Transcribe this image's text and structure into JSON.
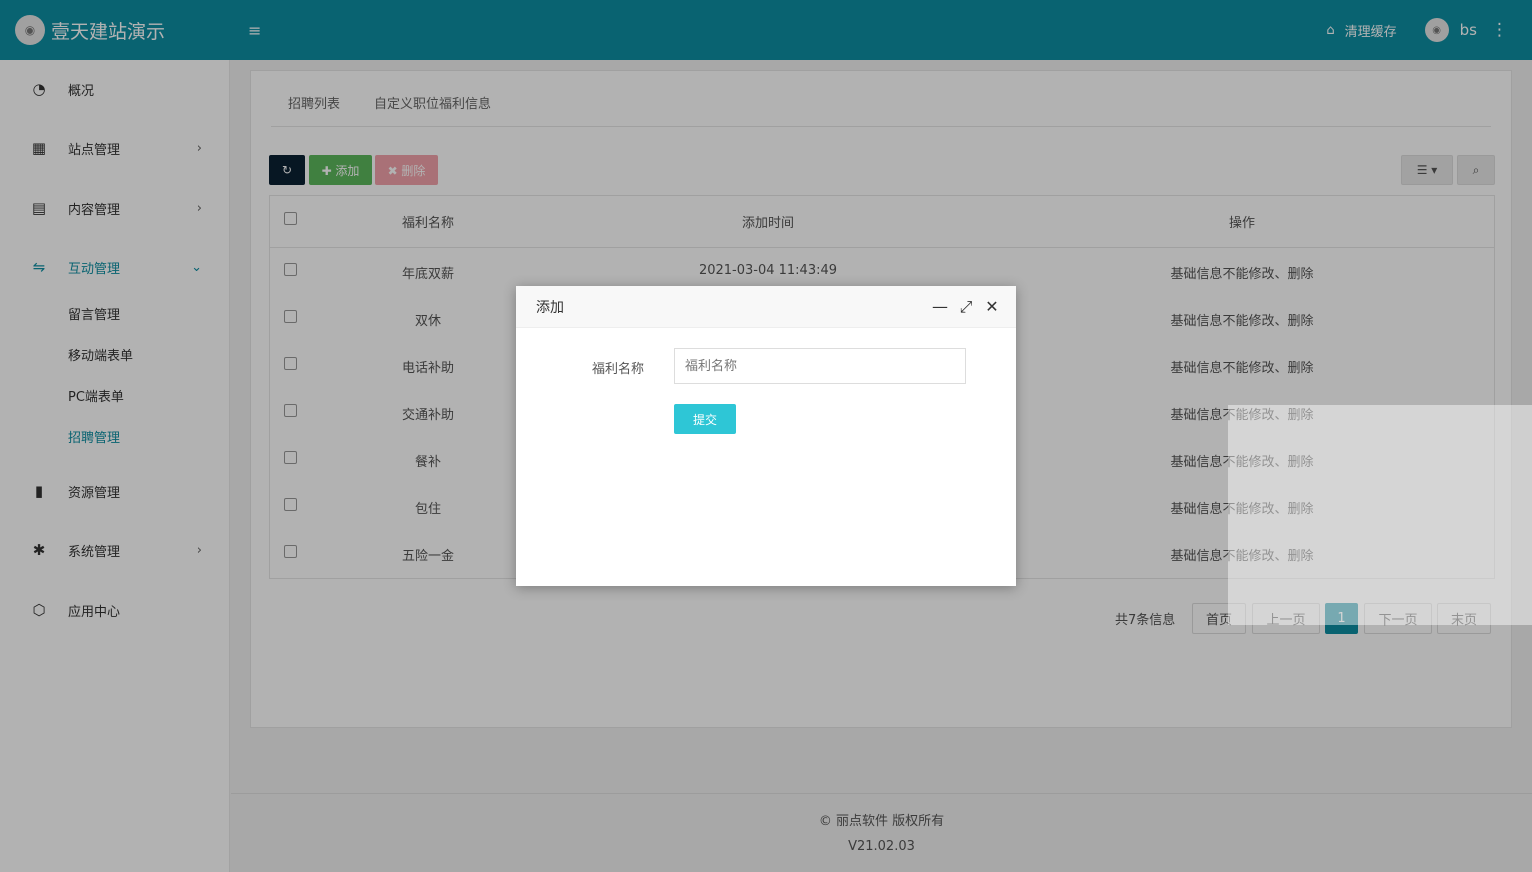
{
  "app": {
    "title": "壹天建站演示",
    "logo_icon": "logo-icon",
    "menu_icon": "≡"
  },
  "header": {
    "clear_cache": "清理缓存",
    "clear_cache_icon": "⌂",
    "user": "bs",
    "more_icon": "⋮"
  },
  "sidebar": {
    "items": [
      {
        "label": "概况",
        "icon": "◔"
      },
      {
        "label": "站点管理",
        "icon": "▦",
        "arrow": "›"
      },
      {
        "label": "内容管理",
        "icon": "▤",
        "arrow": "›"
      },
      {
        "label": "互动管理",
        "icon": "⇋",
        "arrow": "⌄"
      },
      {
        "label": "资源管理",
        "icon": "▮"
      },
      {
        "label": "系统管理",
        "icon": "✱",
        "arrow": "›"
      },
      {
        "label": "应用中心",
        "icon": "⬡"
      }
    ],
    "sub_items": [
      "留言管理",
      "移动端表单",
      "PC端表单",
      "招聘管理"
    ]
  },
  "tabs": [
    "招聘列表",
    "自定义职位福利信息"
  ],
  "toolbar": {
    "refresh_icon": "↻",
    "add": "✚ 添加",
    "delete": "✖ 删除",
    "columns_icon": "☰ ▾",
    "search_icon": "⌕"
  },
  "table": {
    "headers": [
      "福利名称",
      "添加时间",
      "操作"
    ],
    "rows": [
      {
        "name": "年底双薪",
        "time": "2021-03-04 11:43:49",
        "op": "基础信息不能修改、删除"
      },
      {
        "name": "双休",
        "time": "",
        "op": "基础信息不能修改、删除"
      },
      {
        "name": "电话补助",
        "time": "",
        "op": "基础信息不能修改、删除"
      },
      {
        "name": "交通补助",
        "time": "",
        "op": "基础信息不能修改、删除"
      },
      {
        "name": "餐补",
        "time": "",
        "op": "基础信息不能修改、删除"
      },
      {
        "name": "包住",
        "time": "",
        "op": "基础信息不能修改、删除"
      },
      {
        "name": "五险一金",
        "time": "",
        "op": "基础信息不能修改、删除"
      }
    ]
  },
  "pagination": {
    "info": "共7条信息",
    "first": "首页",
    "prev": "上一页",
    "current": "1",
    "next": "下一页",
    "last": "末页"
  },
  "footer": {
    "copyright": "© 丽点软件 版权所有",
    "version": "V21.02.03"
  },
  "modal": {
    "title": "添加",
    "minimize_icon": "—",
    "maximize_icon": "⤢",
    "close_icon": "✕",
    "field_label": "福利名称",
    "field_placeholder": "福利名称",
    "field_value": "",
    "submit": "提交"
  }
}
